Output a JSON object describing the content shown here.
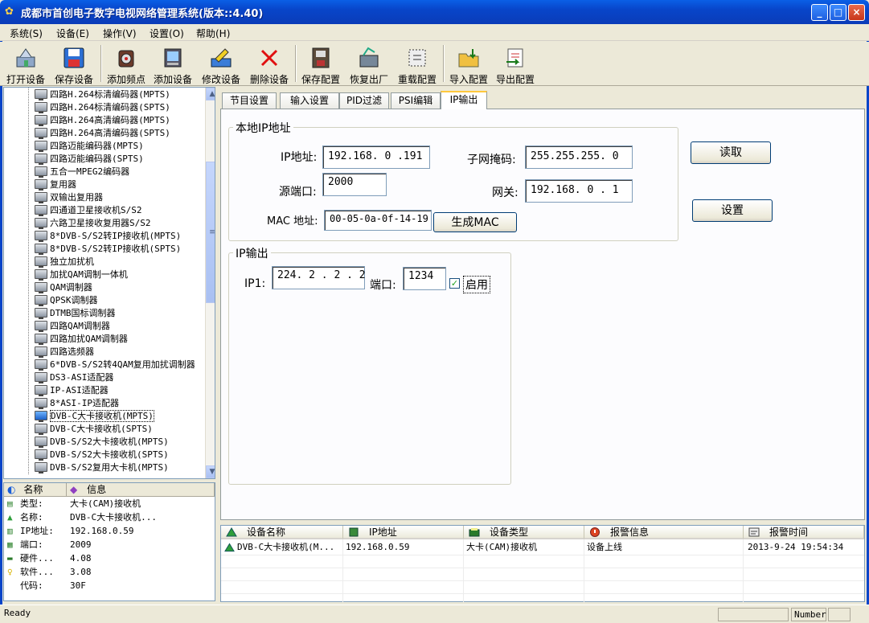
{
  "window": {
    "title": "成都市首创电子数字电视网络管理系统(版本::4.40)",
    "minimize": "_",
    "maximize": "□",
    "close": "×"
  },
  "menu": [
    {
      "label": "系统(S)"
    },
    {
      "label": "设备(E)"
    },
    {
      "label": "操作(V)"
    },
    {
      "label": "设置(O)"
    },
    {
      "label": "帮助(H)"
    }
  ],
  "toolbar": [
    {
      "label": "打开设备",
      "icon": "open-device-icon"
    },
    {
      "label": "保存设备",
      "icon": "save-device-icon"
    },
    {
      "label": "添加频点",
      "icon": "add-frequency-icon"
    },
    {
      "label": "添加设备",
      "icon": "add-device-icon"
    },
    {
      "label": "修改设备",
      "icon": "edit-device-icon"
    },
    {
      "label": "删除设备",
      "icon": "delete-icon"
    },
    {
      "label": "保存配置",
      "icon": "save-config-icon"
    },
    {
      "label": "恢复出厂",
      "icon": "factory-reset-icon"
    },
    {
      "label": "重载配置",
      "icon": "reload-config-icon"
    },
    {
      "label": "导入配置",
      "icon": "import-config-icon"
    },
    {
      "label": "导出配置",
      "icon": "export-config-icon"
    }
  ],
  "tree": {
    "items": [
      "四路H.264标清编码器(MPTS)",
      "四路H.264标清编码器(SPTS)",
      "四路H.264高清编码器(MPTS)",
      "四路H.264高清编码器(SPTS)",
      "四路迈能编码器(MPTS)",
      "四路迈能编码器(SPTS)",
      "五合一MPEG2编码器",
      "复用器",
      "双输出复用器",
      "四通道卫星接收机S/S2",
      "六路卫星接收复用器S/S2",
      "8*DVB-S/S2转IP接收机(MPTS)",
      "8*DVB-S/S2转IP接收机(SPTS)",
      "独立加扰机",
      "加扰QAM调制一体机",
      "QAM调制器",
      "QPSK调制器",
      "DTMB国标调制器",
      "四路QAM调制器",
      "四路加扰QAM调制器",
      "四路选频器",
      "6*DVB-S/S2转4QAM复用加扰调制器",
      "DS3-ASI适配器",
      "IP-ASI适配器",
      "8*ASI-IP适配器",
      "DVB-C大卡接收机(MPTS)",
      "DVB-C大卡接收机(SPTS)",
      "DVB-S/S2大卡接收机(MPTS)",
      "DVB-S/S2大卡接收机(SPTS)",
      "DVB-S/S2复用大卡机(MPTS)"
    ],
    "selected_index": 25,
    "scroll_up": "▲",
    "scroll_down": "▼",
    "scroll_grip": "≡"
  },
  "info_panel": {
    "header_name": "名称",
    "header_info": "信息",
    "rows": [
      {
        "key": "类型:",
        "value": "大卡(CAM)接收机"
      },
      {
        "key": "名称:",
        "value": "DVB-C大卡接收机..."
      },
      {
        "key": "IP地址:",
        "value": "192.168.0.59"
      },
      {
        "key": "端口:",
        "value": "2009"
      },
      {
        "key": "硬件...",
        "value": "4.08"
      },
      {
        "key": "软件...",
        "value": "3.08"
      },
      {
        "key": "代码:",
        "value": "30F"
      }
    ]
  },
  "tabs": [
    {
      "label": "节目设置"
    },
    {
      "label": "输入设置"
    },
    {
      "label": "PID过滤"
    },
    {
      "label": "PSI编辑"
    },
    {
      "label": "IP输出"
    }
  ],
  "active_tab": 4,
  "local_ip": {
    "group_title": "本地IP地址",
    "ip_label": "IP地址:",
    "ip_value": "192.168. 0 .191",
    "mask_label": "子网掩码:",
    "mask_value": "255.255.255. 0",
    "port_label": "源端口:",
    "port_value": "2000",
    "gateway_label": "网关:",
    "gateway_value": "192.168. 0 . 1",
    "mac_label": "MAC 地址:",
    "mac_value": "00-05-0a-0f-14-19",
    "gen_mac_button": "生成MAC"
  },
  "buttons": {
    "read": "读取",
    "set": "设置"
  },
  "ip_output": {
    "group_title": "IP输出",
    "ip1_label": "IP1:",
    "ip1_value": "224. 2 . 2 . 2",
    "port_label": "端口:",
    "port_value": "1234",
    "enable_label": "启用",
    "enable_checked": true
  },
  "device_list": {
    "columns": [
      {
        "label": "设备名称",
        "icon": "device-name-icon"
      },
      {
        "label": "IP地址",
        "icon": "ip-address-icon"
      },
      {
        "label": "设备类型",
        "icon": "device-type-icon"
      },
      {
        "label": "报警信息",
        "icon": "alarm-icon"
      },
      {
        "label": "报警时间",
        "icon": "alarm-time-icon"
      }
    ],
    "rows": [
      {
        "name": "DVB-C大卡接收机(M...",
        "ip": "192.168.0.59",
        "type": "大卡(CAM)接收机",
        "alarm": "设备上线",
        "time": "2013-9-24 19:54:34"
      }
    ]
  },
  "status_bar": {
    "text": "Ready",
    "num": "Number"
  },
  "colors": {
    "titlebar": "#0845c9",
    "window_bg": "#ece9d8",
    "tab_highlight": "#ffc83c"
  }
}
